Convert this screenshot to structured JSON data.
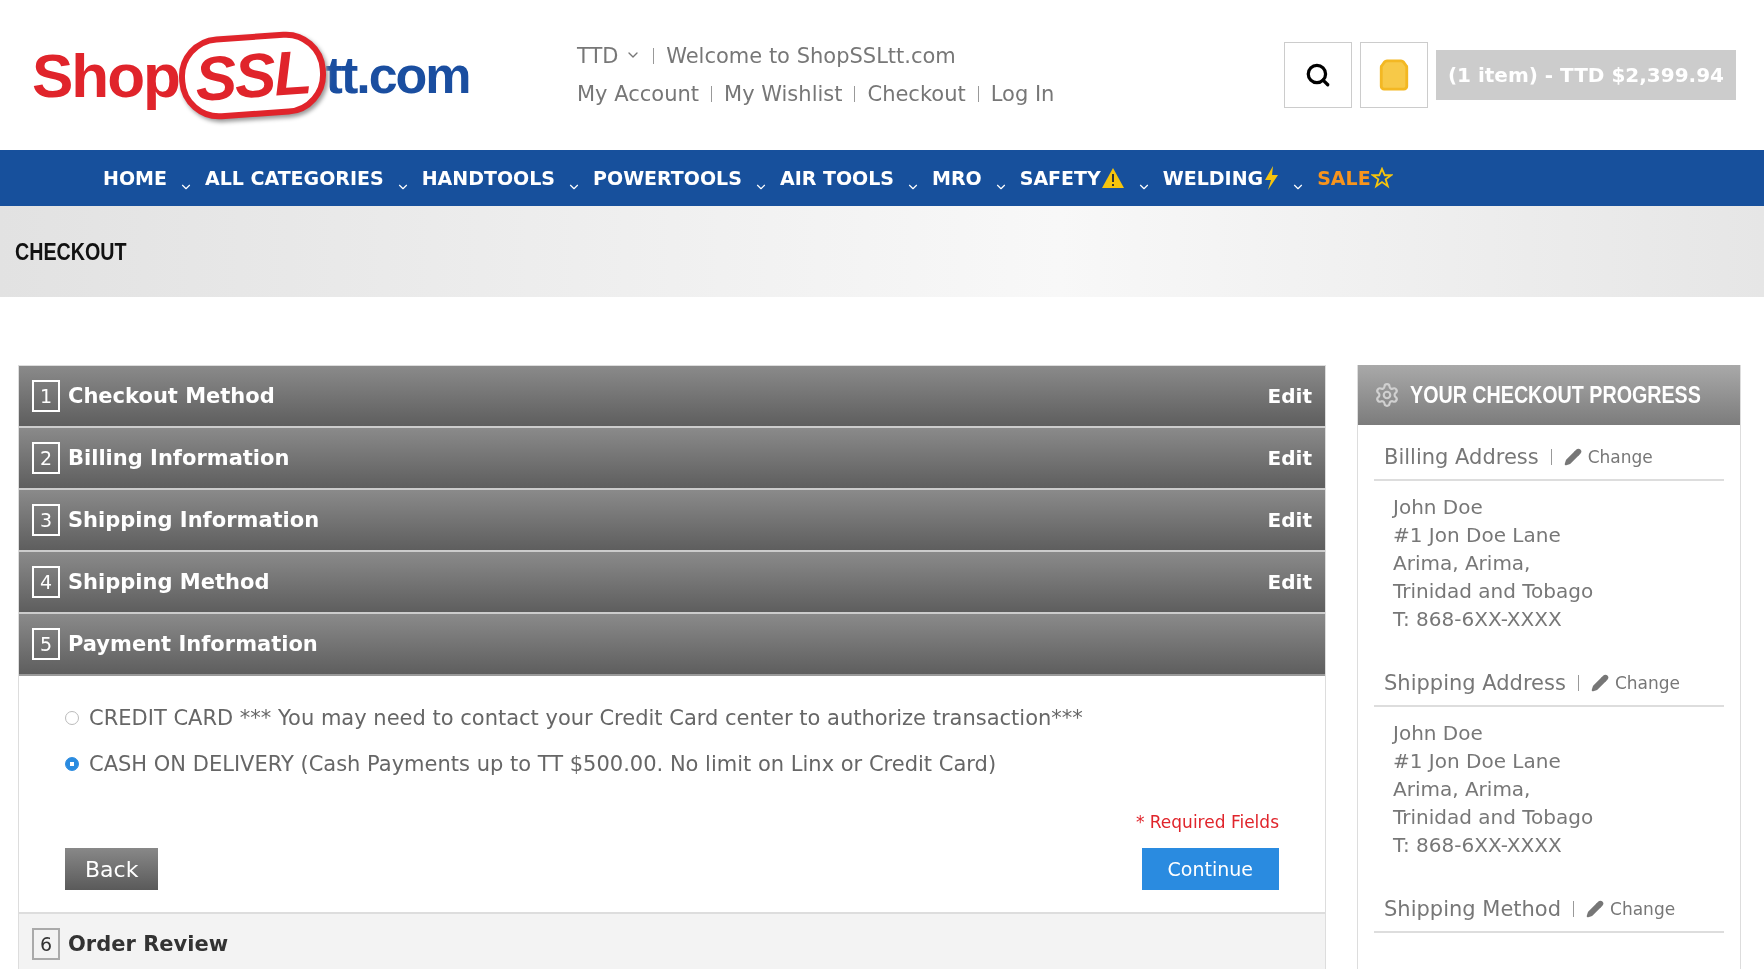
{
  "logo": {
    "part_1": "Shop",
    "part_2": "SSL",
    "part_3": "tt.com"
  },
  "header": {
    "currency": "TTD",
    "welcome": "Welcome to ShopSSLtt.com",
    "links": [
      "My Account",
      "My Wishlist",
      "Checkout",
      "Log In"
    ],
    "cart": "(1 item) - TTD $2,399.94"
  },
  "nav": [
    {
      "label": "HOME",
      "kind": "plain"
    },
    {
      "label": "ALL CATEGORIES",
      "kind": "plain"
    },
    {
      "label": "HANDTOOLS",
      "kind": "plain"
    },
    {
      "label": "POWERTOOLS",
      "kind": "plain"
    },
    {
      "label": "AIR TOOLS",
      "kind": "plain"
    },
    {
      "label": "MRO",
      "kind": "plain"
    },
    {
      "label": "SAFETY",
      "kind": "warning"
    },
    {
      "label": "WELDING",
      "kind": "bolt"
    },
    {
      "label": "SALE",
      "kind": "sale"
    }
  ],
  "page_title": "CHECKOUT",
  "steps": [
    {
      "number": "1",
      "title": "Checkout Method",
      "edit": "Edit",
      "expanded": false,
      "disabled": false
    },
    {
      "number": "2",
      "title": "Billing Information",
      "edit": "Edit",
      "expanded": false,
      "disabled": false
    },
    {
      "number": "3",
      "title": "Shipping Information",
      "edit": "Edit",
      "expanded": false,
      "disabled": false
    },
    {
      "number": "4",
      "title": "Shipping Method",
      "edit": "Edit",
      "expanded": false,
      "disabled": false
    },
    {
      "number": "5",
      "title": "Payment Information",
      "expanded": true,
      "disabled": false
    },
    {
      "number": "6",
      "title": "Order Review",
      "expanded": false,
      "disabled": true
    }
  ],
  "payment_options": [
    {
      "label": "CREDIT CARD *** You may need to contact your Credit Card center to authorize transaction***",
      "selected": false
    },
    {
      "label": "CASH ON DELIVERY (Cash Payments up to TT $500.00. No limit on Linx or Credit Card)",
      "selected": true
    }
  ],
  "required_note": "* Required Fields",
  "buttons": {
    "back": "Back",
    "continue": "Continue"
  },
  "progress": {
    "title": "YOUR CHECKOUT PROGRESS",
    "sections": [
      {
        "title": "Billing Address",
        "action": "Change",
        "lines": [
          "John Doe",
          "#1 Jon Doe Lane",
          "Arima, Arima,",
          "Trinidad and Tobago",
          "T: 868-6XX-XXXX"
        ]
      },
      {
        "title": "Shipping Address",
        "action": "Change",
        "lines": [
          "John Doe",
          "#1 Jon Doe Lane",
          "Arima, Arima,",
          "Trinidad and Tobago",
          "T: 868-6XX-XXXX"
        ]
      },
      {
        "title": "Shipping Method",
        "action": "Change"
      }
    ]
  }
}
